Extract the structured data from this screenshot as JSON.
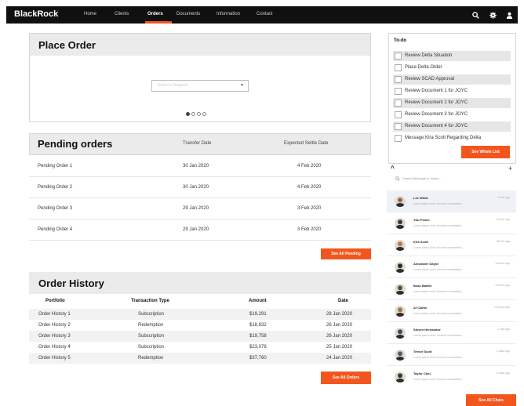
{
  "nav": {
    "brand": "BlackRock",
    "links": [
      "Home",
      "Clients",
      "Orders",
      "Documents",
      "Information",
      "Contact"
    ],
    "active": "Orders",
    "icons": [
      "search-icon",
      "gear-icon",
      "user-icon"
    ]
  },
  "place_order": {
    "title": "Place Order",
    "select_placeholder": "Select a Request",
    "pages": 4,
    "active_page": 1
  },
  "pending": {
    "title": "Pending orders",
    "columns": [
      "Transfer Date",
      "Expected Settle Date"
    ],
    "rows": [
      {
        "name": "Pending Order 1",
        "transfer": "30 Jan 2020",
        "settle": "4 Feb 2020"
      },
      {
        "name": "Pending Order 2",
        "transfer": "30 Jan 2020",
        "settle": "4 Feb 2020"
      },
      {
        "name": "Pending Order 3",
        "transfer": "29 Jan 2020",
        "settle": "3 Feb 2020"
      },
      {
        "name": "Pending Order 4",
        "transfer": "29 Jan 2020",
        "settle": "3 Feb 2020"
      }
    ],
    "button": "See All Pending"
  },
  "history": {
    "title": "Order History",
    "columns": [
      "Portfolio",
      "Transaction Type",
      "Amount",
      "Date"
    ],
    "rows": [
      {
        "portfolio": "Order History 1",
        "type": "Subscription",
        "amount": "$19,291",
        "date": "28 Jan 2020"
      },
      {
        "portfolio": "Order History 2",
        "type": "Redemption",
        "amount": "$18,832",
        "date": "26 Jan 2020"
      },
      {
        "portfolio": "Order History 3",
        "type": "Subscription",
        "amount": "$19,758",
        "date": "26 Jan 2020"
      },
      {
        "portfolio": "Order History 4",
        "type": "Subscription",
        "amount": "$23,078",
        "date": "25 Jan 2020"
      },
      {
        "portfolio": "Order History 5",
        "type": "Redemption",
        "amount": "$37,760",
        "date": "24 Jan 2020"
      }
    ],
    "button": "See All Orders"
  },
  "todo": {
    "title": "To-do",
    "items": [
      "Review Delta Situation",
      "Place Delta Order",
      "Review SCAD Approval",
      "Review Document 1 for JOYC",
      "Review Document 2 for JOYC",
      "Review Document 3 for JOYC",
      "Review Document 4 for JOYC",
      "Message Kira Scott Regarding Delta"
    ],
    "button": "See Whole List"
  },
  "chats": {
    "search_placeholder": "Search Message or Name...",
    "items": [
      {
        "name": "Lee White",
        "msg": "Lorem ipsum dolor sit amet consectetur...",
        "time": "2 min ago",
        "color": "#8a6a55"
      },
      {
        "name": "Yazí Fisher",
        "msg": "Lorem ipsum dolor sit amet consectetur...",
        "time": "18 min ago",
        "color": "#3d3d3d"
      },
      {
        "name": "Kira Scott",
        "msg": "Lorem ipsum dolor sit amet consectetur...",
        "time": "45 min ago",
        "color": "#b07a5a"
      },
      {
        "name": "Alexander Dayne",
        "msg": "Lorem ipsum dolor sit amet consectetur...",
        "time": "3 hours ago",
        "color": "#2c2c2c"
      },
      {
        "name": "Beau Battler",
        "msg": "Lorem ipsum dolor sit amet consectetur...",
        "time": "5 hours ago",
        "color": "#6b4a3a"
      },
      {
        "name": "Al Clarke",
        "msg": "Lorem ipsum dolor sit amet consectetur...",
        "time": "12 hours ago",
        "color": "#a0784c"
      },
      {
        "name": "Steven Hernandez",
        "msg": "Lorem ipsum dolor sit amet consectetur...",
        "time": "1 day ago",
        "color": "#404858"
      },
      {
        "name": "Trevor Scott",
        "msg": "Lorem ipsum dolor sit amet consectetur...",
        "time": "2 days ago",
        "color": "#5a5a5a"
      },
      {
        "name": "Taylor Choi",
        "msg": "Lorem ipsum dolor sit amet consectetur...",
        "time": "3 days ago",
        "color": "#3a3a3a"
      }
    ],
    "button": "See All Chats"
  },
  "colors": {
    "accent": "#f3561d",
    "nav_bg": "#101010",
    "panel_head": "#ebebeb"
  }
}
